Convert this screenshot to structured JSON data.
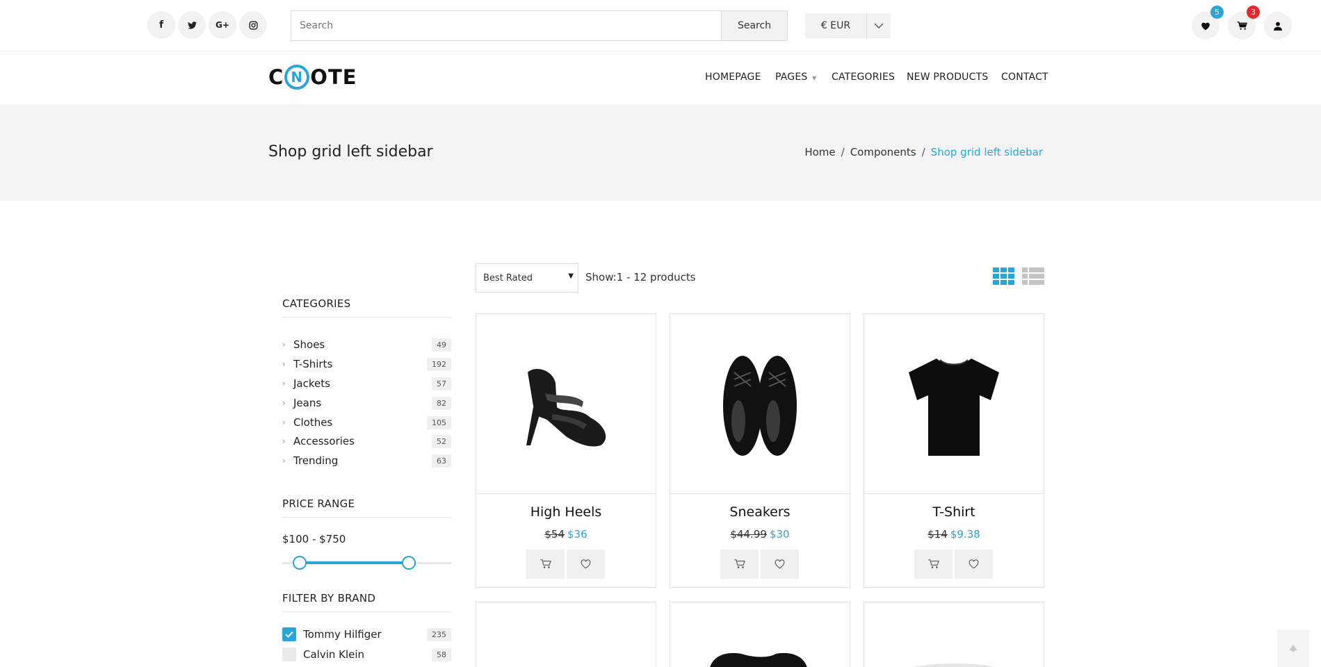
{
  "topbar": {
    "social": [
      {
        "name": "facebook-icon",
        "glyph": "f"
      },
      {
        "name": "twitter-icon",
        "glyph": "t"
      },
      {
        "name": "google-plus-icon",
        "glyph": "G+"
      },
      {
        "name": "instagram-icon",
        "glyph": "ig"
      }
    ],
    "search": {
      "placeholder": "Search",
      "button_label": "Search"
    },
    "currency": {
      "selected": "€ EUR"
    },
    "wishlist_count": "5",
    "cart_count": "3"
  },
  "nav": {
    "logo_left": "C",
    "logo_ring": "N",
    "logo_right": "OTE",
    "items": [
      "HOMEPAGE",
      "PAGES",
      "CATEGORIES",
      "NEW PRODUCTS",
      "CONTACT"
    ]
  },
  "page_header": {
    "title": "Shop grid left sidebar",
    "breadcrumb": [
      "Home",
      "Components",
      "Shop grid left sidebar"
    ],
    "separator": "/"
  },
  "sidebar": {
    "categories_title": "CATEGORIES",
    "categories": [
      {
        "label": "Shoes",
        "count": "49"
      },
      {
        "label": "T-Shirts",
        "count": "192"
      },
      {
        "label": "Jackets",
        "count": "57"
      },
      {
        "label": "Jeans",
        "count": "82"
      },
      {
        "label": "Clothes",
        "count": "105"
      },
      {
        "label": "Accessories",
        "count": "52"
      },
      {
        "label": "Trending",
        "count": "63"
      }
    ],
    "price_title": "PRICE RANGE",
    "price_range": "$100 - $750",
    "brand_title": "FILTER BY BRAND",
    "brands": [
      {
        "label": "Tommy Hilfiger",
        "count": "235",
        "checked": true
      },
      {
        "label": "Calvin Klein",
        "count": "58",
        "checked": false
      }
    ]
  },
  "toolbar": {
    "sort_selected": "Best Rated",
    "show_text": "Show:1 - 12 products"
  },
  "products": [
    {
      "name": "High Heels",
      "old_price": "$54",
      "price": "$36",
      "icon": "heel-shoe-image"
    },
    {
      "name": "Sneakers",
      "old_price": "$44.99",
      "price": "$30",
      "icon": "dress-shoes-image"
    },
    {
      "name": "T-Shirt",
      "old_price": "$14",
      "price": "$9.38",
      "icon": "tshirt-image"
    }
  ],
  "colors": {
    "accent": "#2aa5d8",
    "cart_badge": "#e8262f",
    "wishlist_badge": "#2aa5d8"
  }
}
